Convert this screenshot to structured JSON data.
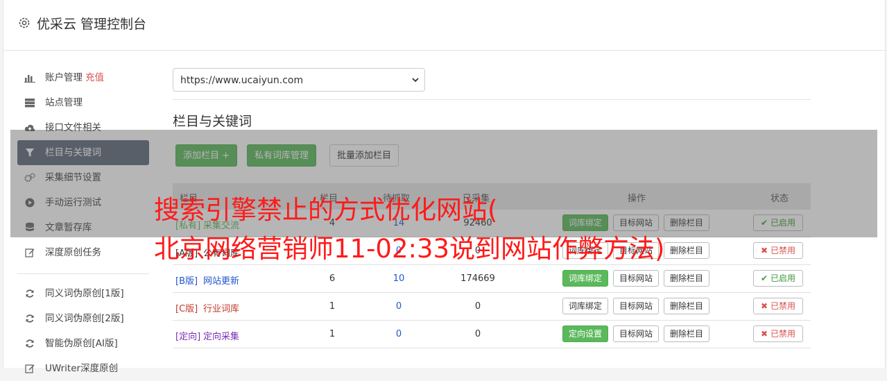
{
  "header": {
    "title": "优采云 管理控制台"
  },
  "sidebar": {
    "items": [
      {
        "label": "账户管理",
        "badge": "充值",
        "icon": "bar-chart-icon"
      },
      {
        "label": "站点管理",
        "icon": "server-icon"
      },
      {
        "label": "接口文件相关",
        "icon": "cloud-upload-icon"
      },
      {
        "label": "栏目与关键词",
        "icon": "filter-icon",
        "active": true
      },
      {
        "label": "采集细节设置",
        "icon": "cogs-icon"
      },
      {
        "label": "手动运行测试",
        "icon": "play-icon"
      },
      {
        "label": "文章暂存库",
        "icon": "database-icon"
      },
      {
        "label": "深度原创任务",
        "icon": "edit-icon"
      }
    ],
    "items2": [
      {
        "label": "同义词伪原创[1版]",
        "icon": "refresh-icon"
      },
      {
        "label": "同义词伪原创[2版]",
        "icon": "refresh-icon"
      },
      {
        "label": "智能伪原创[AI版]",
        "icon": "refresh-icon"
      },
      {
        "label": "UWriter深度原创",
        "icon": "edit-icon"
      }
    ]
  },
  "main": {
    "site_select": "https://www.ucaiyun.com",
    "section_title": "栏目与关键词",
    "buttons": {
      "add": "添加栏目 +",
      "private_lib": "私有词库管理",
      "batch_add": "批量添加栏目"
    },
    "table": {
      "headers": {
        "c1": "栏目",
        "c2": "栏目",
        "c3": "待抓取",
        "c4": "已采集",
        "ops": "操作",
        "status": "状态"
      },
      "rows": [
        {
          "tag": "[私有]",
          "name": "采集交流",
          "n1": "4",
          "n2": "14",
          "n3": "92460",
          "bind": "词库绑定",
          "bind_green": true,
          "target": "目标网站",
          "del": "删除栏目",
          "status": "已启用",
          "on": true,
          "tag_color": "#5cb85c"
        },
        {
          "tag": "[A版]",
          "name": "公有词库",
          "n1": "",
          "n2": "0",
          "n3": "0",
          "bind": "词库绑定",
          "bind_green": false,
          "target": "目标网站",
          "del": "删除栏目",
          "status": "已禁用",
          "on": false,
          "tag_color": "#333"
        },
        {
          "tag": "[B版]",
          "name": "网站更新",
          "n1": "6",
          "n2": "10",
          "n3": "174669",
          "bind": "词库绑定",
          "bind_green": true,
          "target": "目标网站",
          "del": "删除栏目",
          "status": "已启用",
          "on": true,
          "tag_color": "#2255cc"
        },
        {
          "tag": "[C版]",
          "name": "行业词库",
          "n1": "1",
          "n2": "0",
          "n3": "0",
          "bind": "词库绑定",
          "bind_green": false,
          "target": "目标网站",
          "del": "删除栏目",
          "status": "已禁用",
          "on": false,
          "tag_color": "#c0392b"
        },
        {
          "tag": "[定向]",
          "name": "定向采集",
          "n1": "1",
          "n2": "0",
          "n3": "0",
          "bind": "定向设置",
          "bind_green": true,
          "target": "目标网站",
          "del": "删除栏目",
          "status": "已禁用",
          "on": false,
          "tag_color": "#7a2fb5"
        }
      ]
    }
  },
  "watermark": {
    "line1": "搜索引擎禁止的方式优化网站(",
    "line2": "北京网络营销师11-02:33说到网站作弊方法)"
  },
  "colors": {
    "green": "#5cb85c",
    "active_nav": "#5f6a7a",
    "red": "#d9534f",
    "watermark": "#ff1a1a"
  }
}
